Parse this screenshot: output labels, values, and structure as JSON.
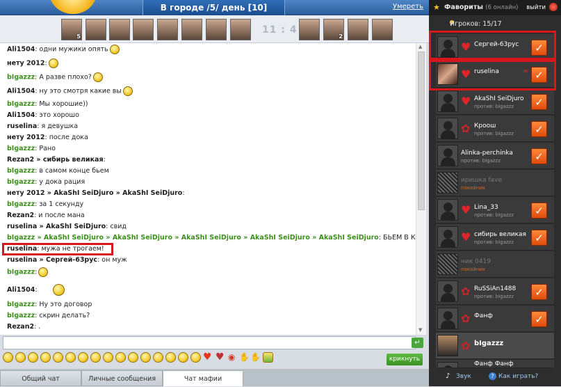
{
  "header": {
    "title": "В городе /5/ день   [10]",
    "die_link": "Умереть"
  },
  "avatars_bar": {
    "badge_first": "5",
    "badge_last": "2",
    "score": "11 : 4"
  },
  "chat": {
    "lines": [
      {
        "nick": "Ali1504",
        "text": ": одни мужики опять"
      },
      {
        "nick": "нету 2012",
        "text": ":"
      },
      {
        "nick": "bIgazzz",
        "text": ": А разве плохо?"
      },
      {
        "nick": "Ali1504",
        "text": ": ну это смотря какие вы"
      },
      {
        "nick": "bIgazzz",
        "text": ": Мы хорошие))"
      },
      {
        "nick": "Ali1504",
        "text": ": это хорошо"
      },
      {
        "nick": "ruselina",
        "text": ": я девушка"
      },
      {
        "nick": "нету 2012",
        "text": ": после дока"
      },
      {
        "nick": "bIgazzz",
        "text": ": Рано"
      },
      {
        "nick": "Rezan2 » сибирь великая",
        "text": ":"
      },
      {
        "nick": "bIgazzz",
        "text": ": в самом конце бьем"
      },
      {
        "nick": "bIgazzz",
        "text": ": у дока рация"
      },
      {
        "nick": "нету 2012 » AkaShI SeiDjuro » AkaShI SeiDjuro",
        "text": ":"
      },
      {
        "nick": "bIgazzz",
        "text": ": за 1 секунду"
      },
      {
        "nick": "Rezan2",
        "text": ": и после мана"
      },
      {
        "nick": "ruselina » AkaShI SeiDjuro",
        "text": ": свид"
      },
      {
        "nick": "bIgazzz » AkaShI SeiDjuro » AkaShI SeiDjuro » AkaShI SeiDjuro » AkaShI SeiDjuro » AkaShI SeiDjuro",
        "text": ": БЬЕМ В КОНЦЕ"
      },
      {
        "nick": "ruselina",
        "text": ": мужа не трогаем!"
      },
      {
        "nick": "ruselina » Сергей-63рус",
        "text": ": он муж"
      },
      {
        "nick": "bIgazzz",
        "text": ":"
      },
      {
        "nick": "Ali1504",
        "text": ":"
      },
      {
        "nick": "bIgazzz",
        "text": ": Ну это договор"
      },
      {
        "nick": "bIgazzz",
        "text": ": скрин делать?"
      },
      {
        "nick": "Rezan2",
        "text": ": ."
      }
    ]
  },
  "input": {
    "value": "",
    "shout_label": "крикнуть"
  },
  "tabs": [
    {
      "label": "Общий чат"
    },
    {
      "label": "Личные сообщения"
    },
    {
      "label": "Чат мафии"
    }
  ],
  "right": {
    "fav_title": "Фавориты",
    "fav_online": "(6 онлайн)",
    "exit_label": "выйти",
    "players_count": "Игроков: 15/17",
    "players": [
      {
        "name": "Сергей-63рус",
        "sub": "",
        "status": "alive",
        "checked": true
      },
      {
        "name": "ruselina",
        "sub": "",
        "status": "alive",
        "checked": true
      },
      {
        "name": "AkaShI SeiDjuro",
        "sub": "против: bIgazzz",
        "status": "alive",
        "checked": true
      },
      {
        "name": "Кроош",
        "sub": "против: bIgazzz",
        "status": "alive",
        "checked": true
      },
      {
        "name": "Alinka-perchinka",
        "sub": "против: bIgazzz",
        "status": "alive",
        "checked": true
      },
      {
        "name": "иришка fave",
        "sub": "покойник",
        "status": "dead",
        "checked": false
      },
      {
        "name": "Lina_33",
        "sub": "против: bIgazzz",
        "status": "alive",
        "checked": true
      },
      {
        "name": "сибирь великая",
        "sub": "против: bIgazzz",
        "status": "alive",
        "checked": true
      },
      {
        "name": "ник 0419",
        "sub": "покойник",
        "status": "dead",
        "checked": false
      },
      {
        "name": "RuSSiAn1488",
        "sub": "против: bIgazzz",
        "status": "alive",
        "checked": true
      },
      {
        "name": "Фанф",
        "sub": "",
        "status": "alive",
        "checked": true
      },
      {
        "name": "bIgazzz",
        "sub": "",
        "status": "self",
        "checked": false
      },
      {
        "name": "Фанф Фанф",
        "sub": "",
        "status": "alive",
        "checked": false
      }
    ],
    "sound_label": "Звук",
    "howto_label": "Как играть?"
  },
  "colors": {
    "header_blue": "#2a5d9c",
    "nick_green": "#3c8f1c",
    "highlight_red": "#d9161c",
    "panel_dark": "#2d2d2d",
    "check_orange": "#e04a0c"
  }
}
